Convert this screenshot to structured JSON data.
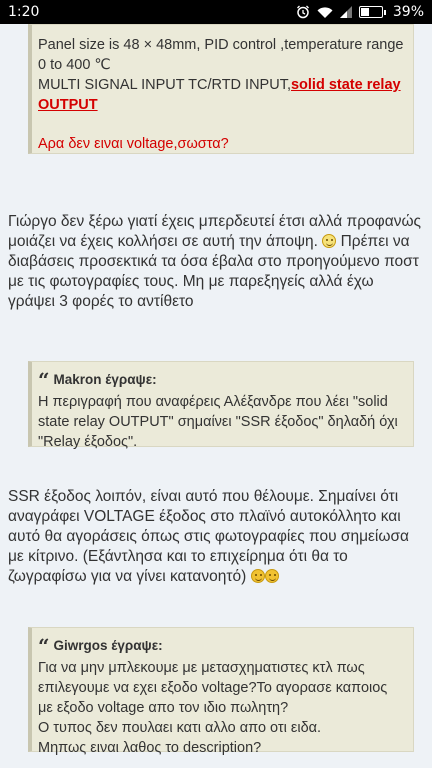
{
  "status_bar": {
    "time": "1:20",
    "battery": "39%",
    "battery_level": 0.39,
    "icons": [
      "alarm-icon",
      "wifi-icon",
      "signal-icon",
      "battery-icon"
    ]
  },
  "quote_top": {
    "line1": "Panel size is 48 × 48mm, PID control ,temperature range 0 to 400 ℃",
    "line2_plain": "MULTI SIGNAL INPUT TC/RTD INPUT,",
    "line2_link": "solid state relay OUTPUT",
    "question": "Αρα δεν ειναι voltage,σωστα?"
  },
  "post1": {
    "part1": "Γιώργο δεν ξέρω γιατί έχεις μπερδευτεί έτσι αλλά προφανώς μοιάζει να έχεις κολλήσει σε αυτή την άποψη.",
    "part2": "Πρέπει να διαβάσεις προσεκτικά τα όσα έβαλα στο προηγούμενο ποστ με τις φωτογραφίες τους. Μη με παρεξηγείς αλλά έχω γράψει 3 φορές το αντίθετο"
  },
  "quote_makron": {
    "author": "Makron έγραψε:",
    "text": "Η περιγραφή που αναφέρεις Αλέξανδρε που λέει \"solid state relay OUTPUT\" σημαίνει \"SSR έξοδος\" δηλαδή όχι \"Relay έξοδος\"."
  },
  "post2": {
    "text": "SSR έξοδος λοιπόν, είναι αυτό που θέλουμε. Σημαίνει ότι αναγράφει VOLTAGE έξοδος στο πλαϊνό αυτοκόλλητο και αυτό θα αγοράσεις όπως στις φωτογραφίες που σημείωσα με κίτρινο. (Εξάντλησα και το επιχείρημα ότι θα το ζωγραφίσω για να γίνει κατανοητό)"
  },
  "quote_giwrgos": {
    "author": "Giwrgos έγραψε:",
    "line1": "Για να μην μπλεκουμε με μετασχηματιστες κτλ πως επιλεγουμε να εχει εξοδο voltage?Το αγορασε καποιος με εξοδο voltage απο τον ιδιο πωλητη?",
    "line2": "Ο τυπος δεν πουλαει κατι αλλο απο οτι ειδα.",
    "line3": "Μηπως ειναι λαθος το description?"
  },
  "colors": {
    "page_bg": "#eef2f6",
    "quote_bg": "#ebead9",
    "highlight_red": "#d40000"
  }
}
